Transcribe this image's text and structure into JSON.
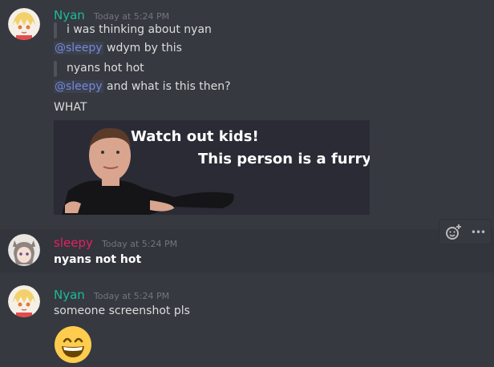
{
  "messages": [
    {
      "author": "Nyan",
      "author_color": "#1abc9c",
      "timestamp": "Today at 5:24 PM",
      "lines": {
        "q1": "i was thinking about nyan",
        "m1": "@sleepy",
        "l1": "wdym by this",
        "q2": "nyans hot hot",
        "m2": "@sleepy",
        "l2": "and what is this then?",
        "l3": "WHAT"
      },
      "gif": {
        "line1": "Watch out kids!",
        "line2": "This person is a furry!"
      }
    },
    {
      "author": "sleepy",
      "author_color": "#e91e63",
      "timestamp": "Today at 5:24 PM",
      "text": "nyans not hot"
    },
    {
      "author": "Nyan",
      "author_color": "#1abc9c",
      "timestamp": "Today at 5:24 PM",
      "text": "someone screenshot pls",
      "emoji": "😄"
    }
  ],
  "toolbar": {
    "add_reaction_icon": "add-reaction-icon",
    "more_icon": "more-icon",
    "more_label": "•••"
  }
}
